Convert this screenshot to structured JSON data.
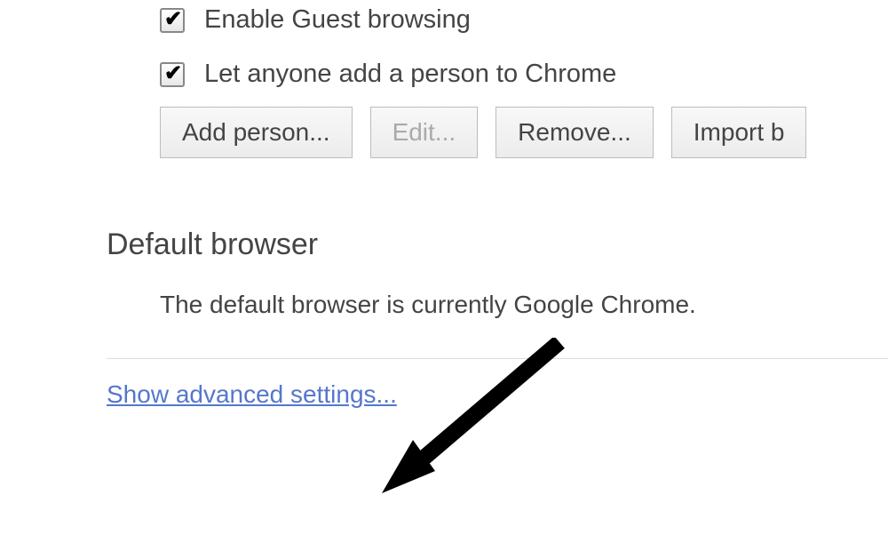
{
  "people": {
    "guest_browsing_label": "Enable Guest browsing",
    "guest_browsing_checked": true,
    "anyone_add_label": "Let anyone add a person to Chrome",
    "anyone_add_checked": true,
    "buttons": {
      "add_person": "Add person...",
      "edit": "Edit...",
      "remove": "Remove...",
      "import": "Import b"
    }
  },
  "default_browser": {
    "heading": "Default browser",
    "status": "The default browser is currently Google Chrome."
  },
  "advanced_link": "Show advanced settings..."
}
